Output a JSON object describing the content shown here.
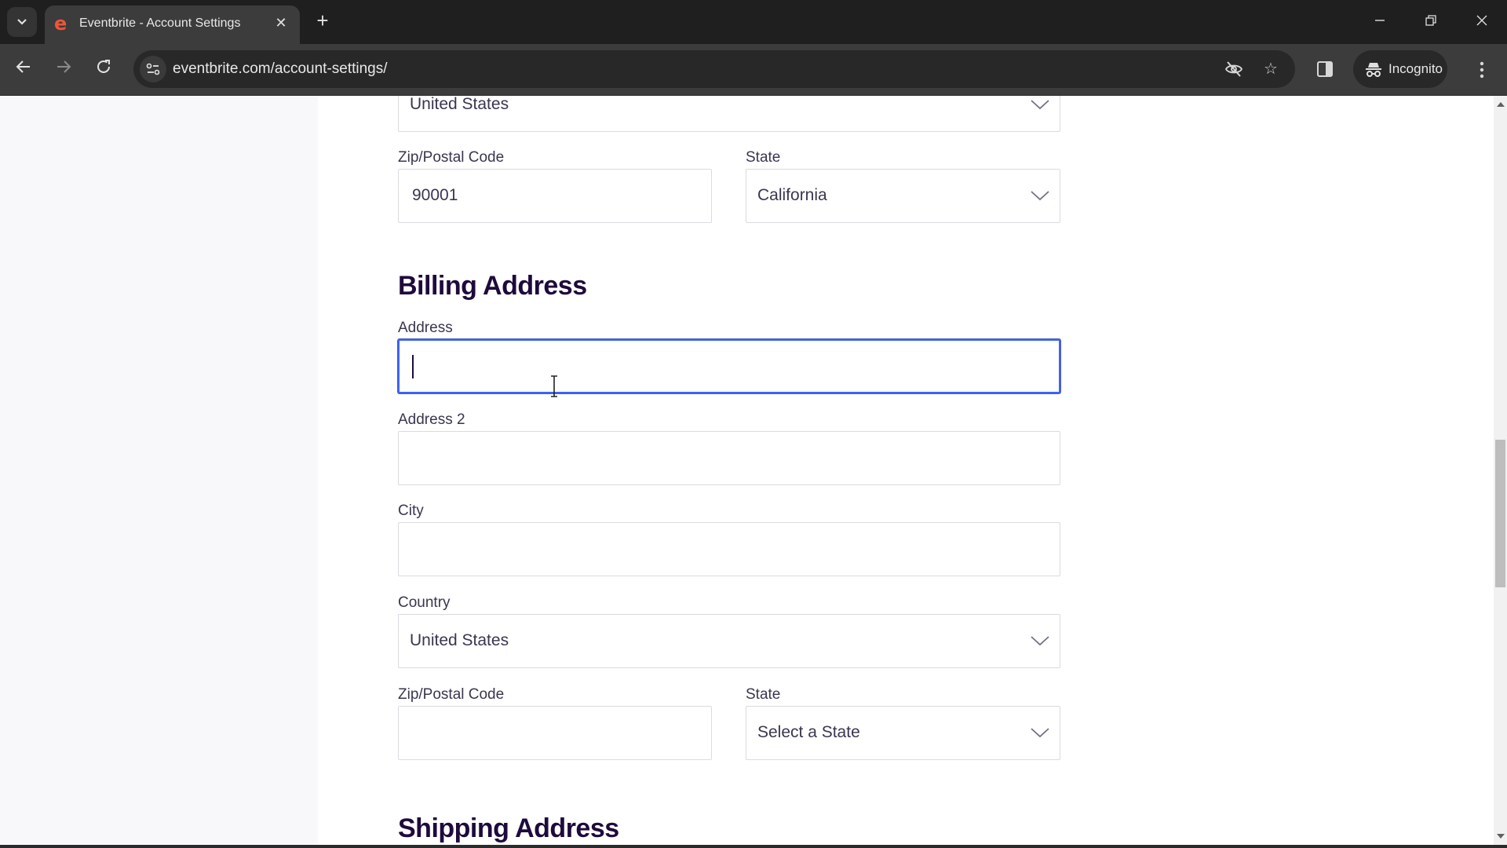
{
  "browser": {
    "tab": {
      "title": "Eventbrite - Account Settings",
      "favicon": "e",
      "favicon_color": "#f05537",
      "close_glyph": "✕"
    },
    "new_tab_glyph": "+",
    "window_controls": {
      "minimize": "—",
      "restore": "❐",
      "close": "✕"
    },
    "nav": {
      "back": "←",
      "forward": "→",
      "reload": "↻"
    },
    "url": "eventbrite.com/account-settings/",
    "icons": {
      "tracking_protection": "eye-off",
      "bookmark": "☆"
    },
    "incognito_label": "Incognito"
  },
  "form": {
    "previous_section": {
      "country_value": "United States",
      "zip_label": "Zip/Postal Code",
      "zip_value": "90001",
      "state_label": "State",
      "state_value": "California"
    },
    "billing": {
      "title": "Billing Address",
      "address_label": "Address",
      "address_value": "",
      "address2_label": "Address 2",
      "address2_value": "",
      "city_label": "City",
      "city_value": "",
      "country_label": "Country",
      "country_value": "United States",
      "zip_label": "Zip/Postal Code",
      "zip_value": "",
      "state_label": "State",
      "state_value": "Select a State"
    },
    "shipping": {
      "title": "Shipping Address"
    }
  },
  "colors": {
    "brand_heading": "#1e0a3c",
    "focus_border": "#3d64ff",
    "label_text": "#39364f"
  }
}
